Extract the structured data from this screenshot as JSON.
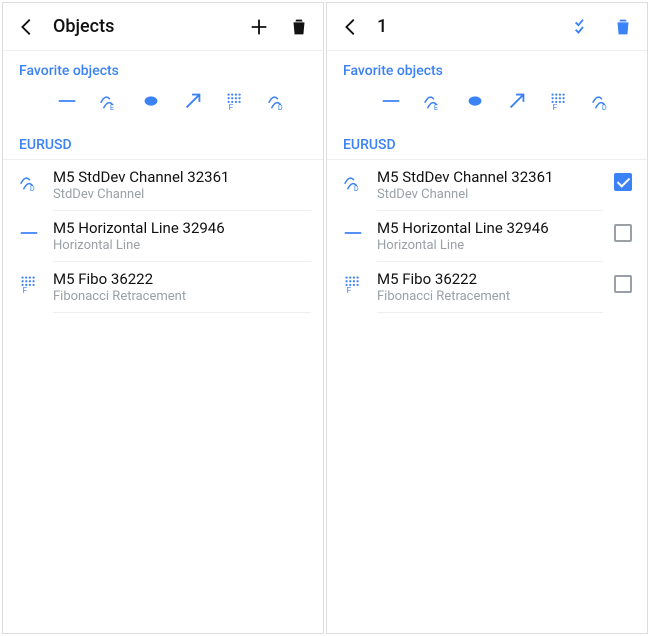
{
  "left": {
    "title": "Objects",
    "favorites_title": "Favorite objects",
    "group_header": "EURUSD",
    "items": [
      {
        "title": "M5 StdDev Channel 32361",
        "sub": "StdDev Channel"
      },
      {
        "title": "M5 Horizontal Line 32946",
        "sub": "Horizontal Line"
      },
      {
        "title": "M5 Fibo 36222",
        "sub": "Fibonacci Retracement"
      }
    ]
  },
  "right": {
    "title": "1",
    "favorites_title": "Favorite objects",
    "group_header": "EURUSD",
    "items": [
      {
        "title": "M5 StdDev Channel 32361",
        "sub": "StdDev Channel",
        "checked": true
      },
      {
        "title": "M5 Horizontal Line 32946",
        "sub": "Horizontal Line",
        "checked": false
      },
      {
        "title": "M5 Fibo 36222",
        "sub": "Fibonacci Retracement",
        "checked": false
      }
    ]
  }
}
